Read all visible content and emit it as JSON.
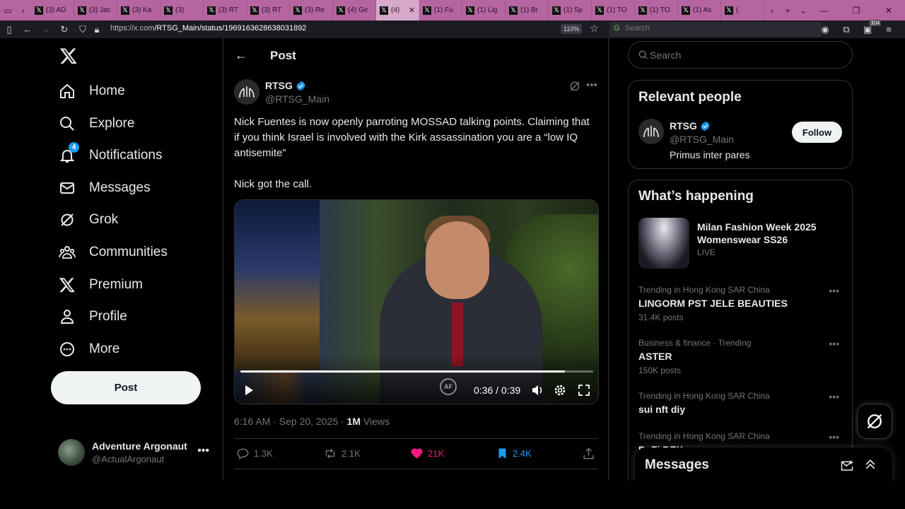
{
  "browser": {
    "tabs": [
      "(3) AD",
      "(3) Jac",
      "(3) Ka",
      "(3)",
      "(3) RT",
      "(3) RT",
      "(3) Re",
      "(4) Ge",
      "(4)",
      "(1) Fu",
      "(1) Lig",
      "(1) Br",
      "(1) Sp",
      "(1) TO",
      "(1) TO",
      "(1) As",
      "("
    ],
    "active_tab_index": 8,
    "url_host": "https://x.com",
    "url_path": "/RTSG_Main/status/1969163628638031892",
    "zoom": "110%",
    "search_placeholder": "Search",
    "ext_badge": "304"
  },
  "sidebar": {
    "items": [
      {
        "label": "Home",
        "icon": "home-icon"
      },
      {
        "label": "Explore",
        "icon": "search-icon"
      },
      {
        "label": "Notifications",
        "icon": "bell-icon",
        "badge": "4"
      },
      {
        "label": "Messages",
        "icon": "mail-icon"
      },
      {
        "label": "Grok",
        "icon": "grok-icon"
      },
      {
        "label": "Communities",
        "icon": "communities-icon"
      },
      {
        "label": "Premium",
        "icon": "x-logo-icon"
      },
      {
        "label": "Profile",
        "icon": "person-icon"
      },
      {
        "label": "More",
        "icon": "more-circle-icon"
      }
    ],
    "post_button": "Post",
    "account": {
      "name": "Adventure Argonaut",
      "handle": "@ActualArgonaut"
    }
  },
  "main": {
    "header_title": "Post",
    "tweet": {
      "author": "RTSG",
      "handle": "@RTSG_Main",
      "text": "Nick Fuentes is now openly parroting MOSSAD talking points. Claiming that if you think Israel is involved with the Kirk assassination you are a “low IQ antisemite”\n\nNick got the call.",
      "video_time": "0:36 / 0:39",
      "video_progress": 0.92,
      "video_watermark": "AF",
      "timestamp": "6:16 AM · Sep 20, 2025 · ",
      "views_count": "1M",
      "views_label": " Views",
      "replies": "1.3K",
      "reposts": "2.1K",
      "likes": "21K",
      "bookmarks": "2.4K"
    }
  },
  "right": {
    "search_placeholder": "Search",
    "relevant": {
      "title": "Relevant people",
      "name": "RTSG",
      "handle": "@RTSG_Main",
      "bio": "Primus inter pares",
      "follow_label": "Follow"
    },
    "happening": {
      "title": "What’s happening",
      "event": {
        "title": "Milan Fashion Week 2025 Womenswear SS26",
        "status": "LIVE"
      },
      "trends": [
        {
          "context": "Trending in Hong Kong SAR China",
          "title": "LINGORM PST JELE BEAUTIES",
          "count": "31.4K posts"
        },
        {
          "context": "Business & finance · Trending",
          "title": "ASTER",
          "count": "150K posts"
        },
        {
          "context": "Trending in Hong Kong SAR China",
          "title": "sui nft diy",
          "count": ""
        },
        {
          "context": "Trending in Hong Kong SAR China",
          "title": "DeFi DEX",
          "count": ""
        }
      ]
    },
    "messages_drawer": "Messages"
  },
  "colors": {
    "accent": "#1d9bf0",
    "like": "#f91880",
    "tabbar": "#b5659f",
    "background": "#000000"
  }
}
